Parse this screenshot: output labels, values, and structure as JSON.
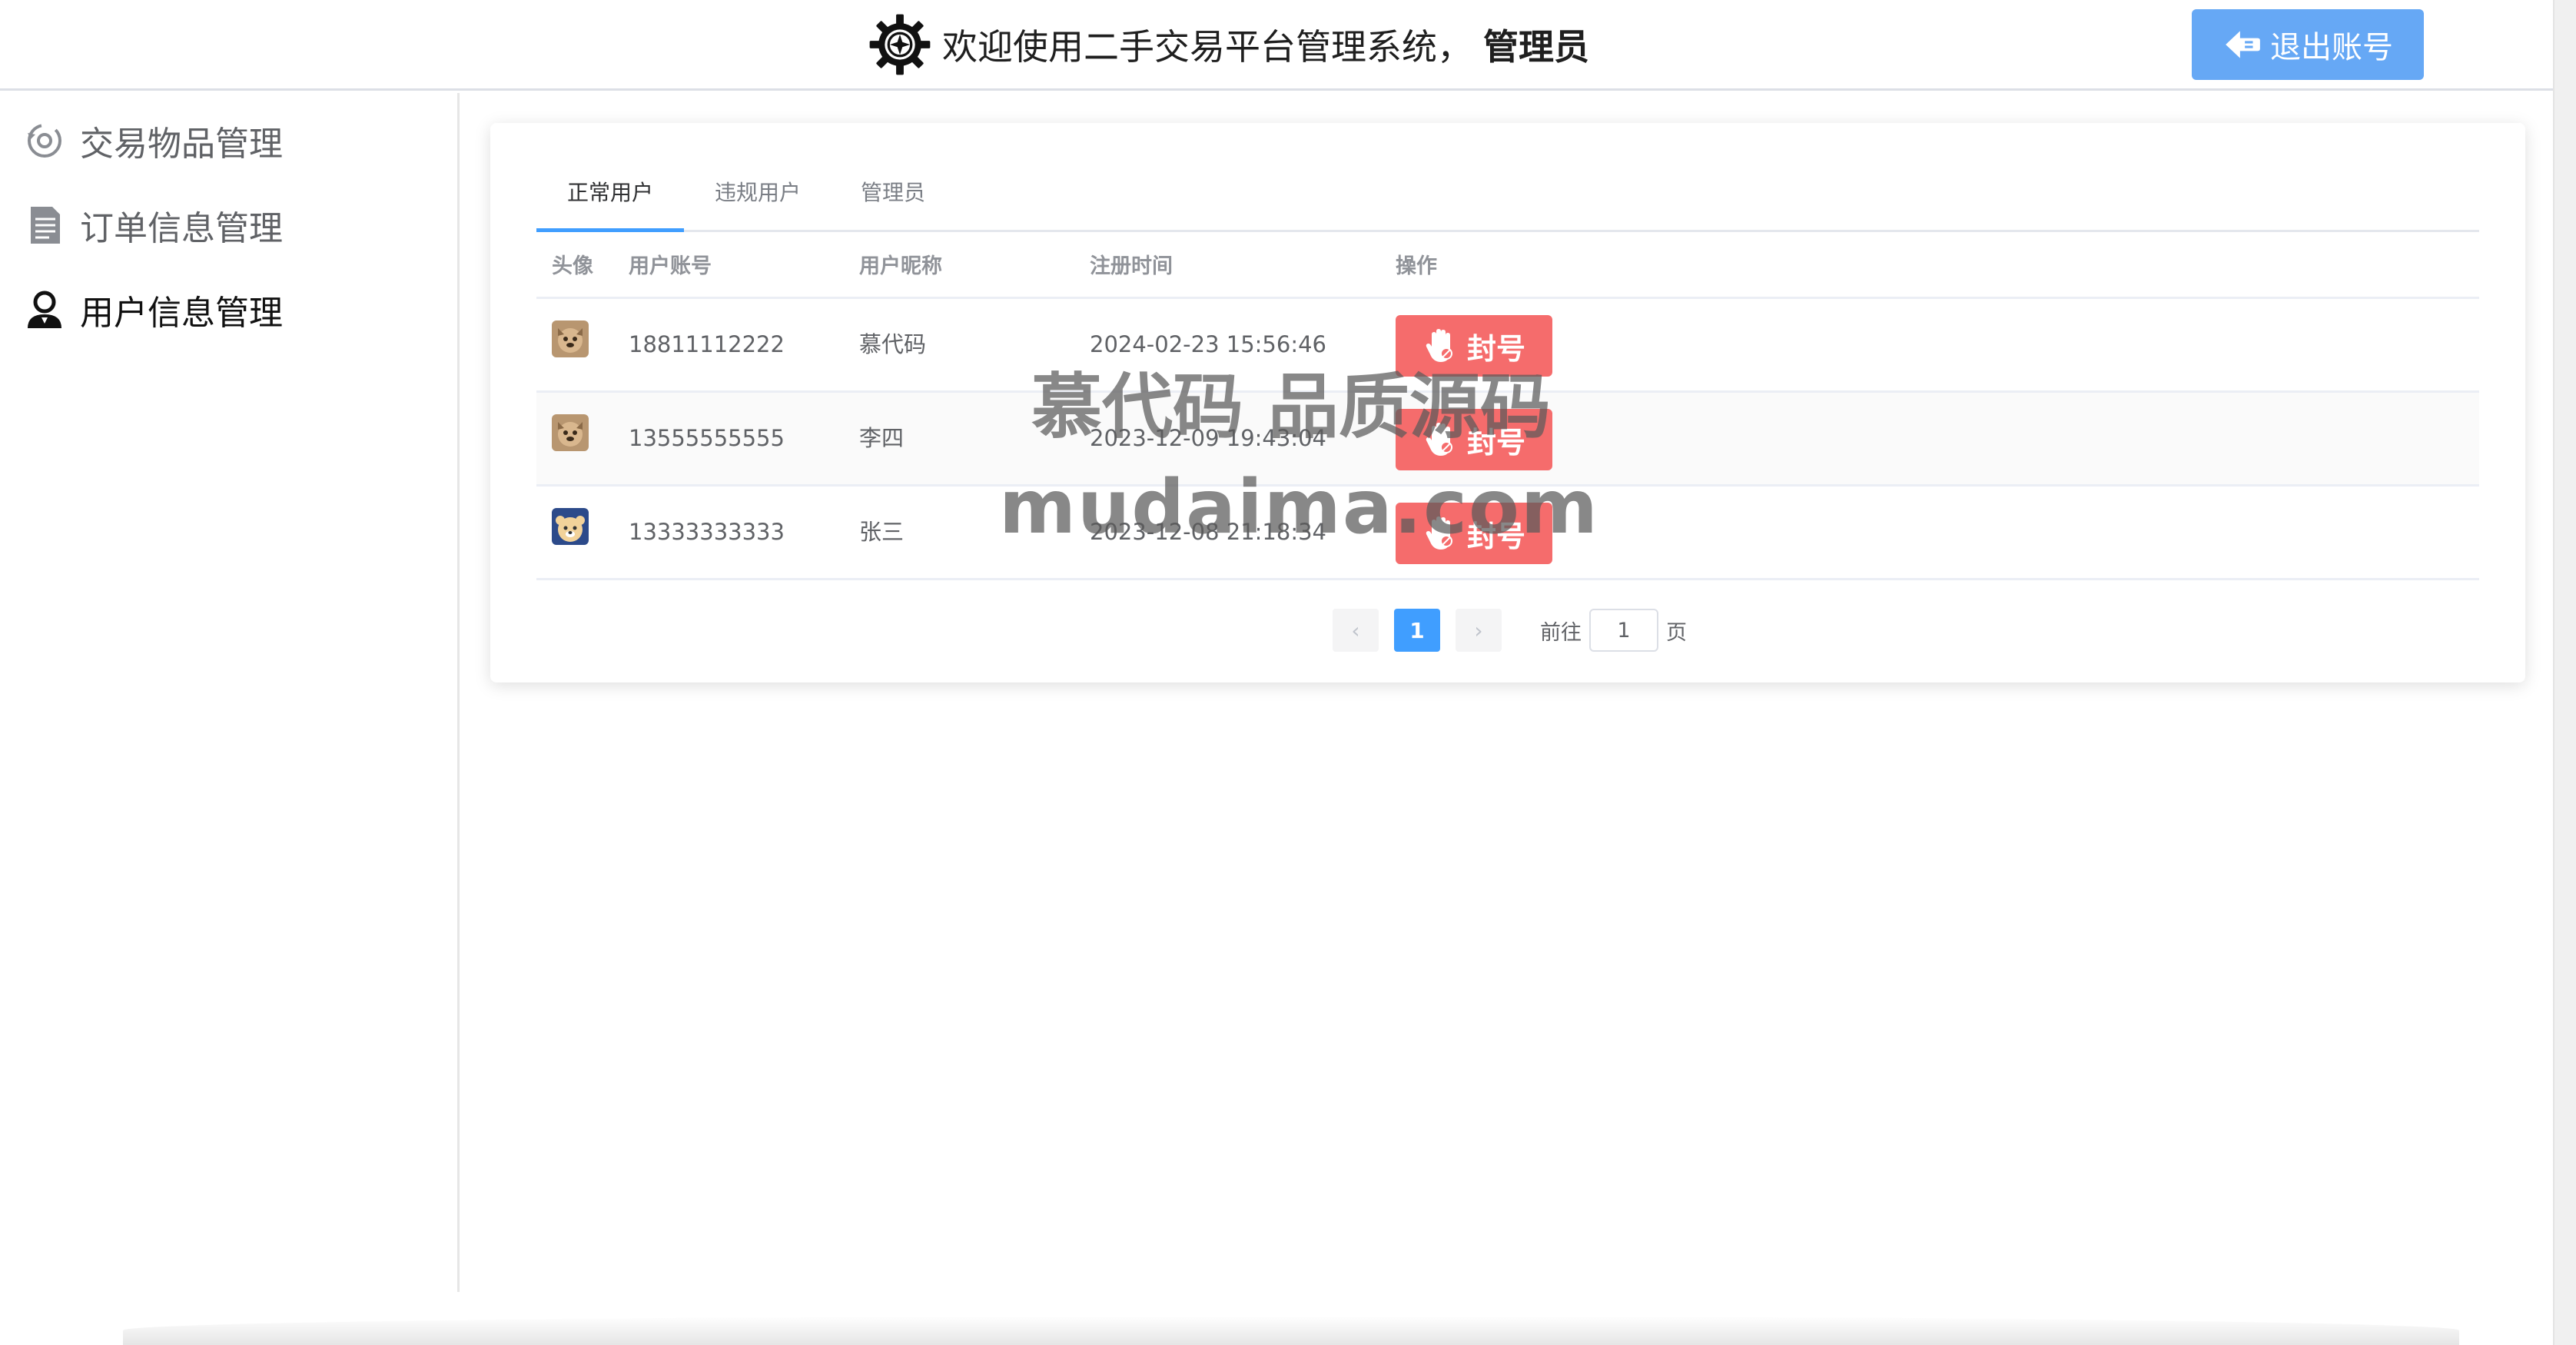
{
  "header": {
    "welcome_text": "欢迎使用二手交易平台管理系统，",
    "role_text": "管理员",
    "logout_label": "退出账号",
    "logout_color": "#66a8f5"
  },
  "sidebar": {
    "items": [
      {
        "label": "交易物品管理",
        "icon": "goods-icon"
      },
      {
        "label": "订单信息管理",
        "icon": "order-icon"
      },
      {
        "label": "用户信息管理",
        "icon": "user-icon",
        "active": true
      }
    ]
  },
  "tabs": [
    {
      "label": "正常用户",
      "active": true
    },
    {
      "label": "违规用户"
    },
    {
      "label": "管理员"
    }
  ],
  "table": {
    "columns": [
      "头像",
      "用户账号",
      "用户昵称",
      "注册时间",
      "操作"
    ],
    "rows": [
      {
        "account": "18811112222",
        "nickname": "慕代码",
        "registered": "2024-02-23 15:56:46",
        "action": "封号"
      },
      {
        "account": "13555555555",
        "nickname": "李四",
        "registered": "2023-12-09 19:43:04",
        "action": "封号"
      },
      {
        "account": "13333333333",
        "nickname": "张三",
        "registered": "2023-12-08 21:18:34",
        "action": "封号"
      }
    ]
  },
  "pagination": {
    "prev_symbol": "‹",
    "current_page": "1",
    "next_symbol": "›",
    "goto_label": "前往",
    "goto_value": "1",
    "page_suffix": "页"
  },
  "watermark": {
    "line1": "慕代码 品质源码",
    "line2": "mudaima.com"
  },
  "colors": {
    "accent": "#409eff",
    "danger": "#f56c6c"
  }
}
